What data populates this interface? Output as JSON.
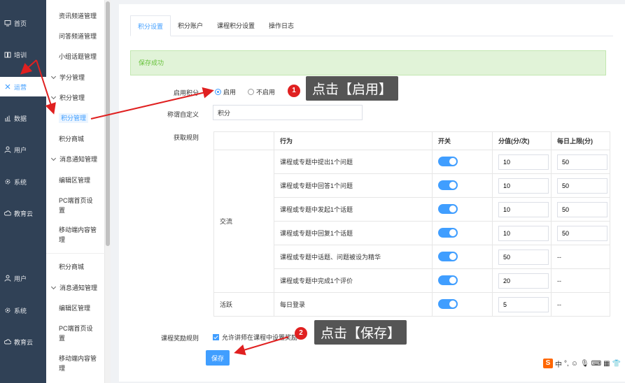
{
  "left_nav": [
    {
      "label": "首页",
      "icon": "monitor-icon"
    },
    {
      "label": "培训",
      "icon": "book-icon"
    },
    {
      "label": "运营",
      "icon": "settings-icon"
    },
    {
      "label": "数据",
      "icon": "chart-icon"
    },
    {
      "label": "用户",
      "icon": "user-icon"
    },
    {
      "label": "系统",
      "icon": "gear-icon"
    },
    {
      "label": "教育云",
      "icon": "cloud-icon"
    },
    {
      "label": "用户",
      "icon": "user-icon"
    },
    {
      "label": "系统",
      "icon": "gear-icon"
    },
    {
      "label": "教育云",
      "icon": "cloud-icon"
    }
  ],
  "sub_nav": [
    "资讯频道管理",
    "问答频道管理",
    "小组话题管理",
    "学分管理",
    "积分管理",
    "积分管理",
    "积分商城",
    "消息通知管理",
    "编辑区管理",
    "PC端首页设置",
    "移动端内容管理",
    "积分商城",
    "消息通知管理",
    "编辑区管理",
    "PC端首页设置",
    "移动端内容管理"
  ],
  "tabs": [
    "积分设置",
    "积分账户",
    "课程积分设置",
    "操作日志"
  ],
  "alert": "保存成功",
  "form": {
    "enable_label": "启用积分",
    "enable_on": "启用",
    "enable_off": "不启用",
    "custom_name_label": "称谓自定义",
    "custom_name_value": "积分",
    "rules_label": "获取规则",
    "course_reward_label": "课程奖励规则",
    "course_reward_checkbox": "允许讲师在课程中设置奖励",
    "save_button": "保存"
  },
  "table": {
    "headers": [
      "行为",
      "开关",
      "分值(分/次)",
      "每日上限(分)"
    ],
    "group_exchange": "交流",
    "group_active": "活跃",
    "rows": [
      {
        "action": "课程或专题中提出1个问题",
        "score": "10",
        "limit": "50"
      },
      {
        "action": "课程或专题中回答1个问题",
        "score": "10",
        "limit": "50"
      },
      {
        "action": "课程或专题中发起1个话题",
        "score": "10",
        "limit": "50"
      },
      {
        "action": "课程或专题中回复1个话题",
        "score": "10",
        "limit": "50"
      },
      {
        "action": "课程或专题中话题、问题被设为精华",
        "score": "50",
        "limit": "--"
      },
      {
        "action": "课程或专题中完成1个评价",
        "score": "20",
        "limit": "--"
      },
      {
        "action": "每日登录",
        "score": "5",
        "limit": "--"
      }
    ]
  },
  "callouts": {
    "step1_number": "1",
    "step1_text": "点击【启用】",
    "step2_number": "2",
    "step2_text": "点击【保存】"
  },
  "ime": {
    "logo": "S",
    "mode": "中"
  },
  "colors": {
    "primary": "#409eff",
    "nav_bg": "#304156",
    "success_bg": "#e1f3d8",
    "success_text": "#67c23a",
    "annotation_red": "#e02020"
  }
}
